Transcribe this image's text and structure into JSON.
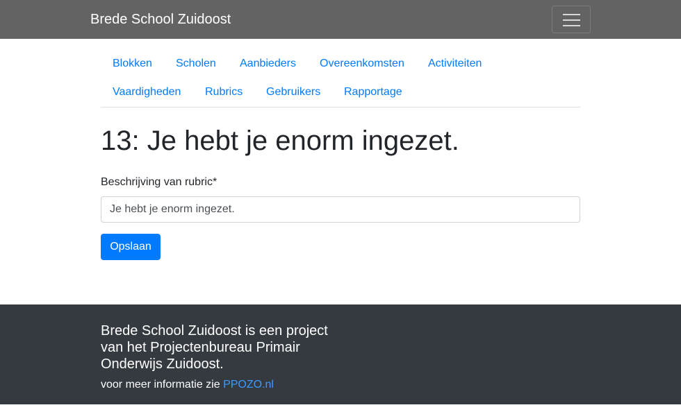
{
  "navbar": {
    "brand": "Brede School Zuidoost",
    "toggler_icon": "hamburger-icon"
  },
  "subnav": {
    "items": [
      {
        "label": "Blokken"
      },
      {
        "label": "Scholen"
      },
      {
        "label": "Aanbieders"
      },
      {
        "label": "Overeenkomsten"
      },
      {
        "label": "Activiteiten"
      },
      {
        "label": "Vaardigheden"
      },
      {
        "label": "Rubrics"
      },
      {
        "label": "Gebruikers"
      },
      {
        "label": "Rapportage"
      }
    ]
  },
  "main": {
    "title": "13: Je hebt je enorm ingezet.",
    "field_label": "Beschrijving van rubric*",
    "field_value": "Je hebt je enorm ingezet.",
    "save_label": "Opslaan"
  },
  "footer": {
    "title": "Brede School Zuidoost is een project van het Projectenbureau Primair Onderwijs Zuidoost.",
    "info_prefix": "voor meer informatie zie ",
    "link_label": "PPOZO.nl"
  },
  "colors": {
    "navbar_bg": "#636363",
    "link": "#007bff",
    "primary_button": "#007bff",
    "footer_bg": "#343a40"
  }
}
